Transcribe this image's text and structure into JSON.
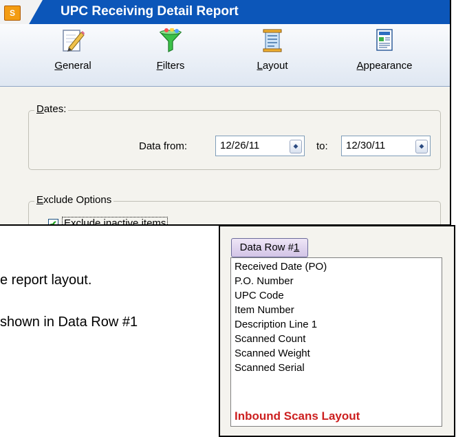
{
  "window": {
    "title": "UPC Receiving Detail Report",
    "app_icon": "report-app-icon"
  },
  "toolbar": {
    "items": [
      {
        "prefix": "",
        "key": "G",
        "rest": "eneral",
        "icon": "pencil-icon"
      },
      {
        "prefix": "",
        "key": "F",
        "rest": "ilters",
        "icon": "funnel-icon"
      },
      {
        "prefix": "",
        "key": "L",
        "rest": "ayout",
        "icon": "layout-icon"
      },
      {
        "prefix": "",
        "key": "A",
        "rest": "ppearance",
        "icon": "appearance-icon"
      }
    ]
  },
  "dates": {
    "group_key": "D",
    "group_rest": "ates:",
    "from_label": "Data from:",
    "from_value": "12/26/11",
    "to_label": "to:",
    "to_value": "12/30/11"
  },
  "exclude": {
    "group_key": "E",
    "group_rest": "xclude Options",
    "checkbox_key": "E",
    "checkbox_rest": "xclude inactive items",
    "checked": true
  },
  "background_text": {
    "line1": "e report layout.",
    "line2": "shown in Data Row #1"
  },
  "panel": {
    "tab_prefix": "Data Row #",
    "tab_key": "1",
    "items": [
      "Received Date (PO)",
      "P.O. Number",
      "UPC Code",
      "Item Number",
      "Description Line 1",
      "Scanned Count",
      "Scanned Weight",
      "Scanned Serial"
    ],
    "layout_name": "Inbound Scans Layout",
    "layout_color": "#cc1f1f"
  },
  "colors": {
    "titlebar": "#0c56b9",
    "accent_check": "#21a121"
  }
}
